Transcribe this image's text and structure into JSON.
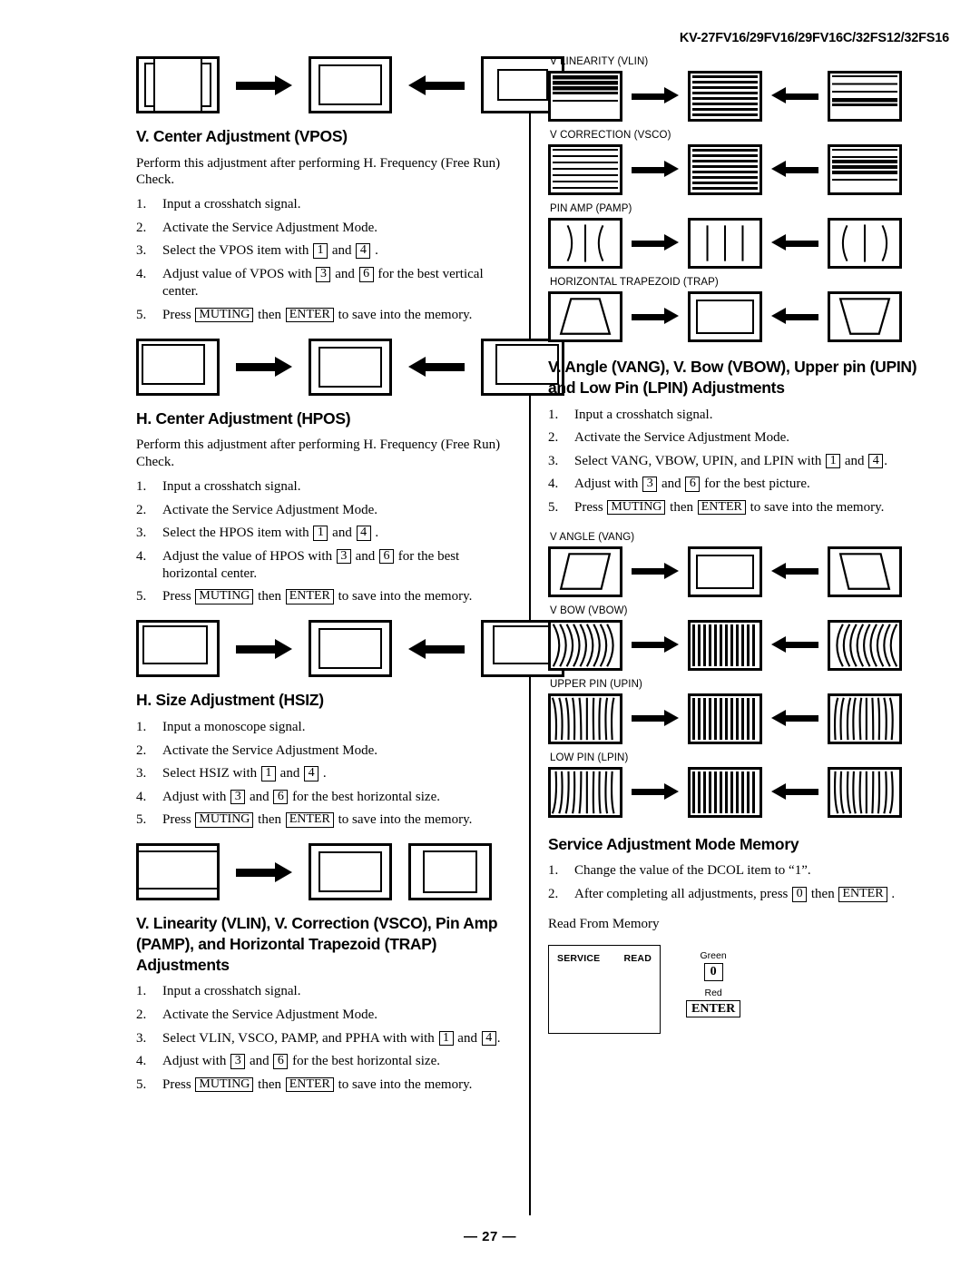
{
  "header": {
    "models": "KV-27FV16/29FV16/29FV16C/32FS12/32FS16"
  },
  "footer": {
    "page_label": "— 27 —"
  },
  "left_column": {
    "diagram_vpos_above": {
      "name": "h-size-too-wide-to-correct",
      "panels": [
        "inner too wide",
        "centered",
        "inner too narrow"
      ]
    },
    "section_vpos": {
      "heading": "V. Center Adjustment (VPOS)",
      "lead": "Perform this adjustment after performing H. Frequency (Free Run) Check.",
      "steps": [
        {
          "num": "1.",
          "parts": [
            {
              "t": "text",
              "v": "Input a crosshatch signal."
            }
          ]
        },
        {
          "num": "2.",
          "parts": [
            {
              "t": "text",
              "v": "Activate the Service Adjustment Mode."
            }
          ]
        },
        {
          "num": "3.",
          "parts": [
            {
              "t": "text",
              "v": "Select the VPOS item with "
            },
            {
              "t": "key",
              "v": "1"
            },
            {
              "t": "text",
              "v": " and "
            },
            {
              "t": "key",
              "v": "4"
            },
            {
              "t": "text",
              "v": " ."
            }
          ]
        },
        {
          "num": "4.",
          "parts": [
            {
              "t": "text",
              "v": "Adjust value of VPOS with "
            },
            {
              "t": "key",
              "v": "3"
            },
            {
              "t": "text",
              "v": " and "
            },
            {
              "t": "key",
              "v": "6"
            },
            {
              "t": "text",
              "v": " for the best vertical center."
            }
          ]
        },
        {
          "num": "5.",
          "parts": [
            {
              "t": "text",
              "v": "Press "
            },
            {
              "t": "key",
              "v": "MUTING"
            },
            {
              "t": "text",
              "v": " then "
            },
            {
              "t": "key",
              "v": "ENTER"
            },
            {
              "t": "text",
              "v": " to save into the memory."
            }
          ]
        }
      ]
    },
    "section_hpos": {
      "heading": "H. Center Adjustment (HPOS)",
      "lead": "Perform this adjustment after performing H. Frequency (Free Run) Check.",
      "steps": [
        {
          "num": "1.",
          "parts": [
            {
              "t": "text",
              "v": "Input a crosshatch signal."
            }
          ]
        },
        {
          "num": "2.",
          "parts": [
            {
              "t": "text",
              "v": "Activate the Service Adjustment Mode."
            }
          ]
        },
        {
          "num": "3.",
          "parts": [
            {
              "t": "text",
              "v": "Select the HPOS item with "
            },
            {
              "t": "key",
              "v": "1"
            },
            {
              "t": "text",
              "v": " and "
            },
            {
              "t": "key",
              "v": "4"
            },
            {
              "t": "text",
              "v": " ."
            }
          ]
        },
        {
          "num": "4.",
          "parts": [
            {
              "t": "text",
              "v": "Adjust the value of HPOS with "
            },
            {
              "t": "key",
              "v": "3"
            },
            {
              "t": "text",
              "v": " and "
            },
            {
              "t": "key",
              "v": "6"
            },
            {
              "t": "text",
              "v": " for the best horizontal center."
            }
          ]
        },
        {
          "num": "5.",
          "parts": [
            {
              "t": "text",
              "v": "Press "
            },
            {
              "t": "key",
              "v": "MUTING"
            },
            {
              "t": "text",
              "v": " then "
            },
            {
              "t": "key",
              "v": "ENTER"
            },
            {
              "t": "text",
              "v": " to save into the memory."
            }
          ]
        }
      ]
    },
    "section_hsiz": {
      "heading": "H. Size Adjustment (HSIZ)",
      "steps": [
        {
          "num": "1.",
          "parts": [
            {
              "t": "text",
              "v": "Input a monoscope signal."
            }
          ]
        },
        {
          "num": "2.",
          "parts": [
            {
              "t": "text",
              "v": "Activate the Service Adjustment Mode."
            }
          ]
        },
        {
          "num": "3.",
          "parts": [
            {
              "t": "text",
              "v": "Select HSIZ with "
            },
            {
              "t": "key",
              "v": "1"
            },
            {
              "t": "text",
              "v": " and "
            },
            {
              "t": "key",
              "v": "4"
            },
            {
              "t": "text",
              "v": " ."
            }
          ]
        },
        {
          "num": "4.",
          "parts": [
            {
              "t": "text",
              "v": "Adjust with "
            },
            {
              "t": "key",
              "v": "3"
            },
            {
              "t": "text",
              "v": " and "
            },
            {
              "t": "key",
              "v": "6"
            },
            {
              "t": "text",
              "v": " for the best horizontal size."
            }
          ]
        },
        {
          "num": "5.",
          "parts": [
            {
              "t": "text",
              "v": "Press "
            },
            {
              "t": "key",
              "v": "MUTING"
            },
            {
              "t": "text",
              "v": " then "
            },
            {
              "t": "key",
              "v": "ENTER"
            },
            {
              "t": "text",
              "v": " to save into the memory."
            }
          ]
        }
      ]
    },
    "section_vlin": {
      "heading": "V. Linearity (VLIN), V. Correction (VSCO), Pin Amp (PAMP), and Horizontal Trapezoid (TRAP) Adjustments",
      "steps": [
        {
          "num": "1.",
          "parts": [
            {
              "t": "text",
              "v": "Input a crosshatch signal."
            }
          ]
        },
        {
          "num": "2.",
          "parts": [
            {
              "t": "text",
              "v": "Activate the Service Adjustment Mode."
            }
          ]
        },
        {
          "num": "3.",
          "parts": [
            {
              "t": "text",
              "v": "Select VLIN, VSCO, PAMP, and PPHA with with "
            },
            {
              "t": "key",
              "v": "1"
            },
            {
              "t": "text",
              "v": " and "
            },
            {
              "t": "key",
              "v": "4"
            },
            {
              "t": "text",
              "v": "."
            }
          ]
        },
        {
          "num": "4.",
          "parts": [
            {
              "t": "text",
              "v": "Adjust with "
            },
            {
              "t": "key",
              "v": "3"
            },
            {
              "t": "text",
              "v": " and "
            },
            {
              "t": "key",
              "v": "6"
            },
            {
              "t": "text",
              "v": " for the best horizontal size."
            }
          ]
        },
        {
          "num": "5.",
          "parts": [
            {
              "t": "text",
              "v": "Press "
            },
            {
              "t": "key",
              "v": "MUTING"
            },
            {
              "t": "text",
              "v": " then "
            },
            {
              "t": "key",
              "v": "ENTER"
            },
            {
              "t": "text",
              "v": " to save into the memory."
            }
          ]
        }
      ]
    }
  },
  "right_column": {
    "diagrams_top": [
      {
        "label": "V LINEARITY (VLIN)",
        "kind": "hstripe"
      },
      {
        "label": "V CORRECTION (VSCO)",
        "kind": "hstripe"
      },
      {
        "label": "PIN AMP (PAMP)",
        "kind": "pincushion"
      },
      {
        "label": "HORIZONTAL TRAPEZOID (TRAP)",
        "kind": "trapezoid"
      }
    ],
    "section_vang": {
      "heading": "V. Angle (VANG), V. Bow (VBOW), Upper pin (UPIN) and Low Pin (LPIN) Adjustments",
      "steps": [
        {
          "num": "1.",
          "parts": [
            {
              "t": "text",
              "v": "Input a crosshatch signal."
            }
          ]
        },
        {
          "num": "2.",
          "parts": [
            {
              "t": "text",
              "v": "Activate the Service Adjustment Mode."
            }
          ]
        },
        {
          "num": "3.",
          "parts": [
            {
              "t": "text",
              "v": "Select VANG, VBOW, UPIN, and LPIN with "
            },
            {
              "t": "key",
              "v": "1"
            },
            {
              "t": "text",
              "v": " and "
            },
            {
              "t": "key",
              "v": "4"
            },
            {
              "t": "text",
              "v": "."
            }
          ]
        },
        {
          "num": "4.",
          "parts": [
            {
              "t": "text",
              "v": "Adjust with "
            },
            {
              "t": "key",
              "v": "3"
            },
            {
              "t": "text",
              "v": " and "
            },
            {
              "t": "key",
              "v": "6"
            },
            {
              "t": "text",
              "v": " for the best picture."
            }
          ]
        },
        {
          "num": "5.",
          "parts": [
            {
              "t": "text",
              "v": "Press "
            },
            {
              "t": "key",
              "v": "MUTING"
            },
            {
              "t": "text",
              "v": " then "
            },
            {
              "t": "key",
              "v": "ENTER"
            },
            {
              "t": "text",
              "v": " to save into the memory."
            }
          ]
        }
      ]
    },
    "diagrams_bottom": [
      {
        "label": "V ANGLE (VANG)",
        "kind": "parallelogram"
      },
      {
        "label": "V BOW (VBOW)",
        "kind": "bow"
      },
      {
        "label": "UPPER PIN (UPIN)",
        "kind": "upperpin"
      },
      {
        "label": "LOW PIN (LPIN)",
        "kind": "lowpin"
      }
    ],
    "section_memory": {
      "heading": "Service Adjustment Mode Memory",
      "steps": [
        {
          "num": "1.",
          "parts": [
            {
              "t": "text",
              "v": "Change the value of the DCOL item to “1”."
            }
          ]
        },
        {
          "num": "2.",
          "parts": [
            {
              "t": "text",
              "v": "After completing all adjustments, press "
            },
            {
              "t": "key",
              "v": "0"
            },
            {
              "t": "text",
              "v": " then "
            },
            {
              "t": "key",
              "v": "ENTER"
            },
            {
              "t": "text",
              "v": " ."
            }
          ]
        }
      ],
      "read_from_memory": "Read From Memory",
      "osd": {
        "left_label": "SERVICE",
        "right_label": "READ"
      },
      "key_legend": [
        {
          "color_label": "Green",
          "cap": "0"
        },
        {
          "color_label": "Red",
          "cap": "ENTER"
        }
      ]
    }
  }
}
